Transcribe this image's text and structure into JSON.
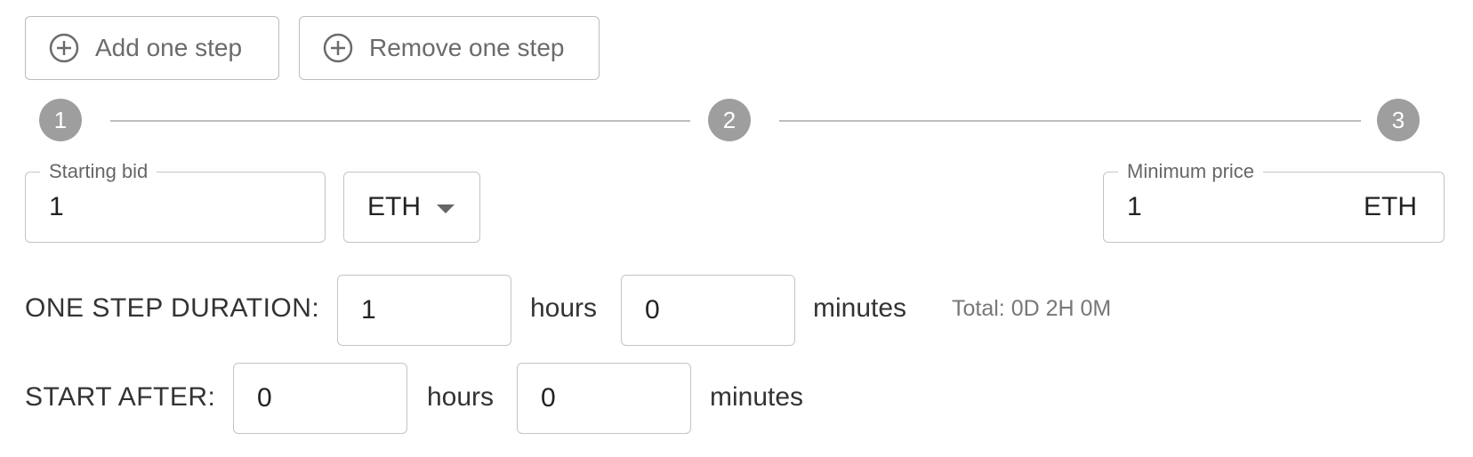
{
  "buttons": {
    "add_label": "Add one step",
    "remove_label": "Remove one step"
  },
  "steps": [
    "1",
    "2",
    "3"
  ],
  "starting_bid": {
    "legend": "Starting bid",
    "value": "1"
  },
  "currency_select": {
    "selected": "ETH"
  },
  "minimum_price": {
    "legend": "Minimum price",
    "value": "1",
    "suffix": "ETH"
  },
  "one_step_duration": {
    "label": "ONE STEP DURATION:",
    "hours_value": "1",
    "hours_unit": "hours",
    "minutes_value": "0",
    "minutes_unit": "minutes",
    "total": "Total: 0D 2H 0M"
  },
  "start_after": {
    "label": "START AFTER:",
    "hours_value": "0",
    "hours_unit": "hours",
    "minutes_value": "0",
    "minutes_unit": "minutes"
  },
  "colors": {
    "step_circle": "#9e9e9e",
    "border": "#c4c4c4",
    "muted_text": "#6b6b6b"
  }
}
